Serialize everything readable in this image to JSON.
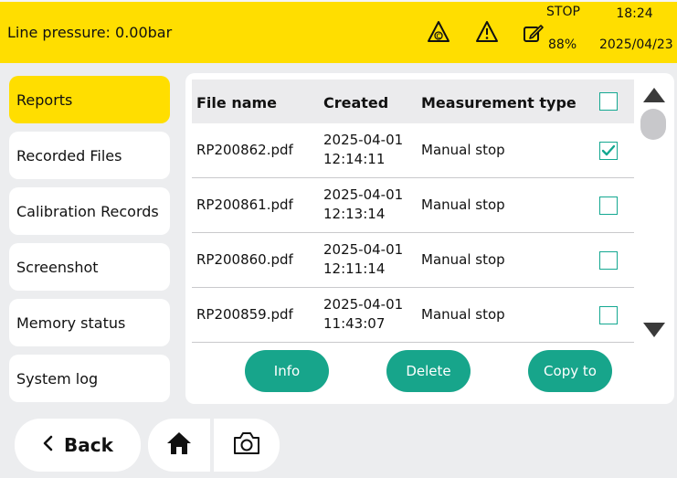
{
  "header": {
    "line_pressure": "Line pressure: 0.00bar",
    "stop_label": "STOP",
    "battery": "88%",
    "time": "18:24",
    "date": "2025/04/23",
    "icons": [
      "calibration-warning-icon",
      "warning-icon",
      "edit-stop-icon"
    ]
  },
  "sidebar": {
    "items": [
      {
        "label": "Reports",
        "active": true
      },
      {
        "label": "Recorded Files"
      },
      {
        "label": "Calibration Records"
      },
      {
        "label": "Screenshot"
      },
      {
        "label": "Memory status"
      },
      {
        "label": "System log"
      }
    ]
  },
  "table": {
    "columns": [
      "File name",
      "Created",
      "Measurement type"
    ],
    "rows": [
      {
        "file": "RP200862.pdf",
        "date": "2025-04-01",
        "time": "12:14:11",
        "type": "Manual stop",
        "checked": true
      },
      {
        "file": "RP200861.pdf",
        "date": "2025-04-01",
        "time": "12:13:14",
        "type": "Manual stop",
        "checked": false
      },
      {
        "file": "RP200860.pdf",
        "date": "2025-04-01",
        "time": "12:11:14",
        "type": "Manual stop",
        "checked": false
      },
      {
        "file": "RP200859.pdf",
        "date": "2025-04-01",
        "time": "11:43:07",
        "type": "Manual stop",
        "checked": false
      }
    ]
  },
  "actions": {
    "info": "Info",
    "delete": "Delete",
    "copy": "Copy to"
  },
  "footer": {
    "back": "Back"
  },
  "colors": {
    "accent_yellow": "#ffde00",
    "accent_green": "#17a58b",
    "background": "#ecedef"
  }
}
